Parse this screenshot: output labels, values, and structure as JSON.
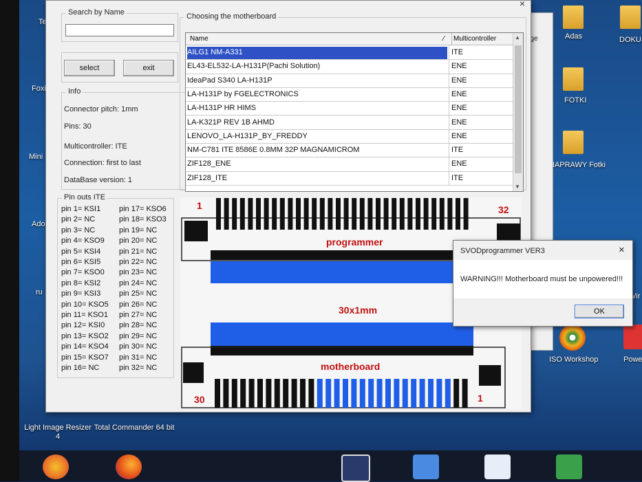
{
  "desktop": {
    "icons": [
      {
        "label": "Adas",
        "icon": "folder-icon"
      },
      {
        "label": "DOKU",
        "icon": "folder-icon"
      },
      {
        "label": "FOTKI",
        "icon": "folder-icon"
      },
      {
        "label": "NAPRAWY Fotki",
        "icon": "folder-icon"
      },
      {
        "label": "ISO Workshop",
        "icon": "disc-icon"
      },
      {
        "label": "Power",
        "icon": "app-icon"
      },
      {
        "label": "Light Image Resizer 4",
        "icon": "app-icon"
      },
      {
        "label": "Total Commander 64 bit",
        "icon": "app-icon"
      }
    ],
    "left_partials": [
      "Te",
      "Foxi",
      "Mini",
      "Ado",
      "ru"
    ],
    "right_partial": "Wir",
    "back_window_text": "age"
  },
  "window": {
    "close": "×",
    "search": {
      "legend": "Search by Name",
      "value": ""
    },
    "buttons": {
      "select": "select",
      "exit": "exit"
    },
    "info": {
      "legend": "Info",
      "lines": [
        "Connector pitch: 1mm",
        "Pins: 30",
        "Multicontroller: ITE",
        "Connection: first to last",
        "DataBase version: 1"
      ]
    },
    "motherboard_group": {
      "legend": "Choosing the motherboard"
    },
    "grid": {
      "headers": {
        "name": "Name",
        "multi": "Multicontroller"
      },
      "rows": [
        {
          "name": "AILG1 NM-A331",
          "multi": "ITE"
        },
        {
          "name": "EL43-EL532-LA-H131P(Pachi Solution)",
          "multi": "ENE"
        },
        {
          "name": "IdeaPad S340 LA-H131P",
          "multi": "ENE"
        },
        {
          "name": "LA-H131P by FGELECTRONICS",
          "multi": "ENE"
        },
        {
          "name": "LA-H131P HR HIMS",
          "multi": "ENE"
        },
        {
          "name": "LA-K321P REV 1B AHMD",
          "multi": "ENE"
        },
        {
          "name": "LENOVO_LA-H131P_BY_FREDDY",
          "multi": "ENE"
        },
        {
          "name": "NM-C781 ITE 8586E 0.8MM 32P MAGNAMICROM",
          "multi": "ITE"
        },
        {
          "name": "ZIF128_ENE",
          "multi": "ENE"
        },
        {
          "name": "ZIF128_ITE",
          "multi": "ITE"
        }
      ]
    },
    "pinouts": {
      "legend": "Pin outs ITE",
      "left": [
        "pin 1= KSI1",
        "pin 2= NC",
        "pin 3= NC",
        "pin 4= KSO9",
        "pin 5= KSI4",
        "pin 6= KSI5",
        "pin 7= KSO0",
        "pin 8= KSI2",
        "pin 9= KSI3",
        "pin 10= KSO5",
        "pin 11= KSO1",
        "pin 12= KSI0",
        "pin 13= KSO2",
        "pin 14= KSO4",
        "pin 15= KSO7",
        "pin 16= NC"
      ],
      "right": [
        "pin 17= KSO6",
        "pin 18= KSO3",
        "pin 19= NC",
        "pin 20= NC",
        "pin 21= NC",
        "pin 22= NC",
        "pin 23= NC",
        "pin 24= NC",
        "pin 25= NC",
        "pin 26= NC",
        "pin 27= NC",
        "pin 28= NC",
        "pin 29= NC",
        "pin 30= NC",
        "pin 31= NC",
        "pin 32= NC"
      ]
    },
    "diagram": {
      "top_left_pin": "1",
      "top_right_pin": "32",
      "programmer_label": "programmer",
      "cable_label": "30x1mm",
      "motherboard_label": "motherboard",
      "bottom_left_pin": "30",
      "bottom_right_pin": "1",
      "top_pins": 32,
      "bottom_pins": 30,
      "bottom_blue_pins": 18,
      "colors": {
        "pin": "#111111",
        "accent": "#1f5fe8",
        "label": "#c01010"
      }
    }
  },
  "dialog": {
    "title": "SVODprogrammer VER3",
    "close": "×",
    "message": "WARNING!!! Motherboard must be unpowered!!!",
    "ok": "OK"
  }
}
